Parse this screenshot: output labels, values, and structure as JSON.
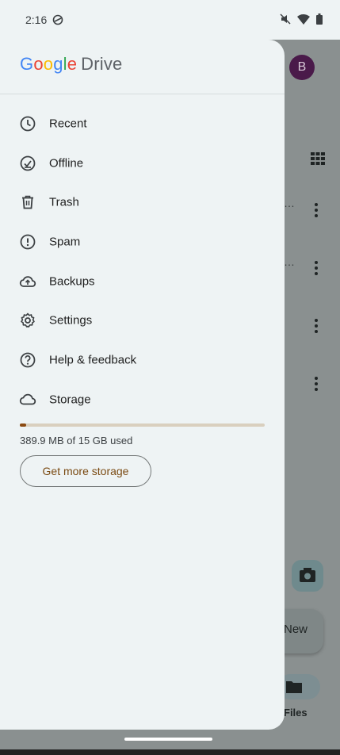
{
  "status_bar": {
    "time": "2:16"
  },
  "drawer": {
    "logo_google": "Google",
    "logo_drive": "Drive",
    "items": [
      {
        "label": "Recent",
        "icon": "clock-icon"
      },
      {
        "label": "Offline",
        "icon": "offline-check-icon"
      },
      {
        "label": "Trash",
        "icon": "trash-icon"
      },
      {
        "label": "Spam",
        "icon": "spam-icon"
      },
      {
        "label": "Backups",
        "icon": "cloud-upload-icon"
      },
      {
        "label": "Settings",
        "icon": "gear-icon"
      },
      {
        "label": "Help & feedback",
        "icon": "help-icon"
      },
      {
        "label": "Storage",
        "icon": "cloud-icon"
      }
    ],
    "storage": {
      "used_text": "389.9 MB of 15 GB used",
      "used_fraction": 0.026,
      "button_label": "Get more storage",
      "bar_color": "#8b4a12",
      "track_color": "#d9cfbe"
    }
  },
  "background_app": {
    "avatar_letter": "B",
    "new_button_label": "New",
    "files_label": "Files"
  }
}
